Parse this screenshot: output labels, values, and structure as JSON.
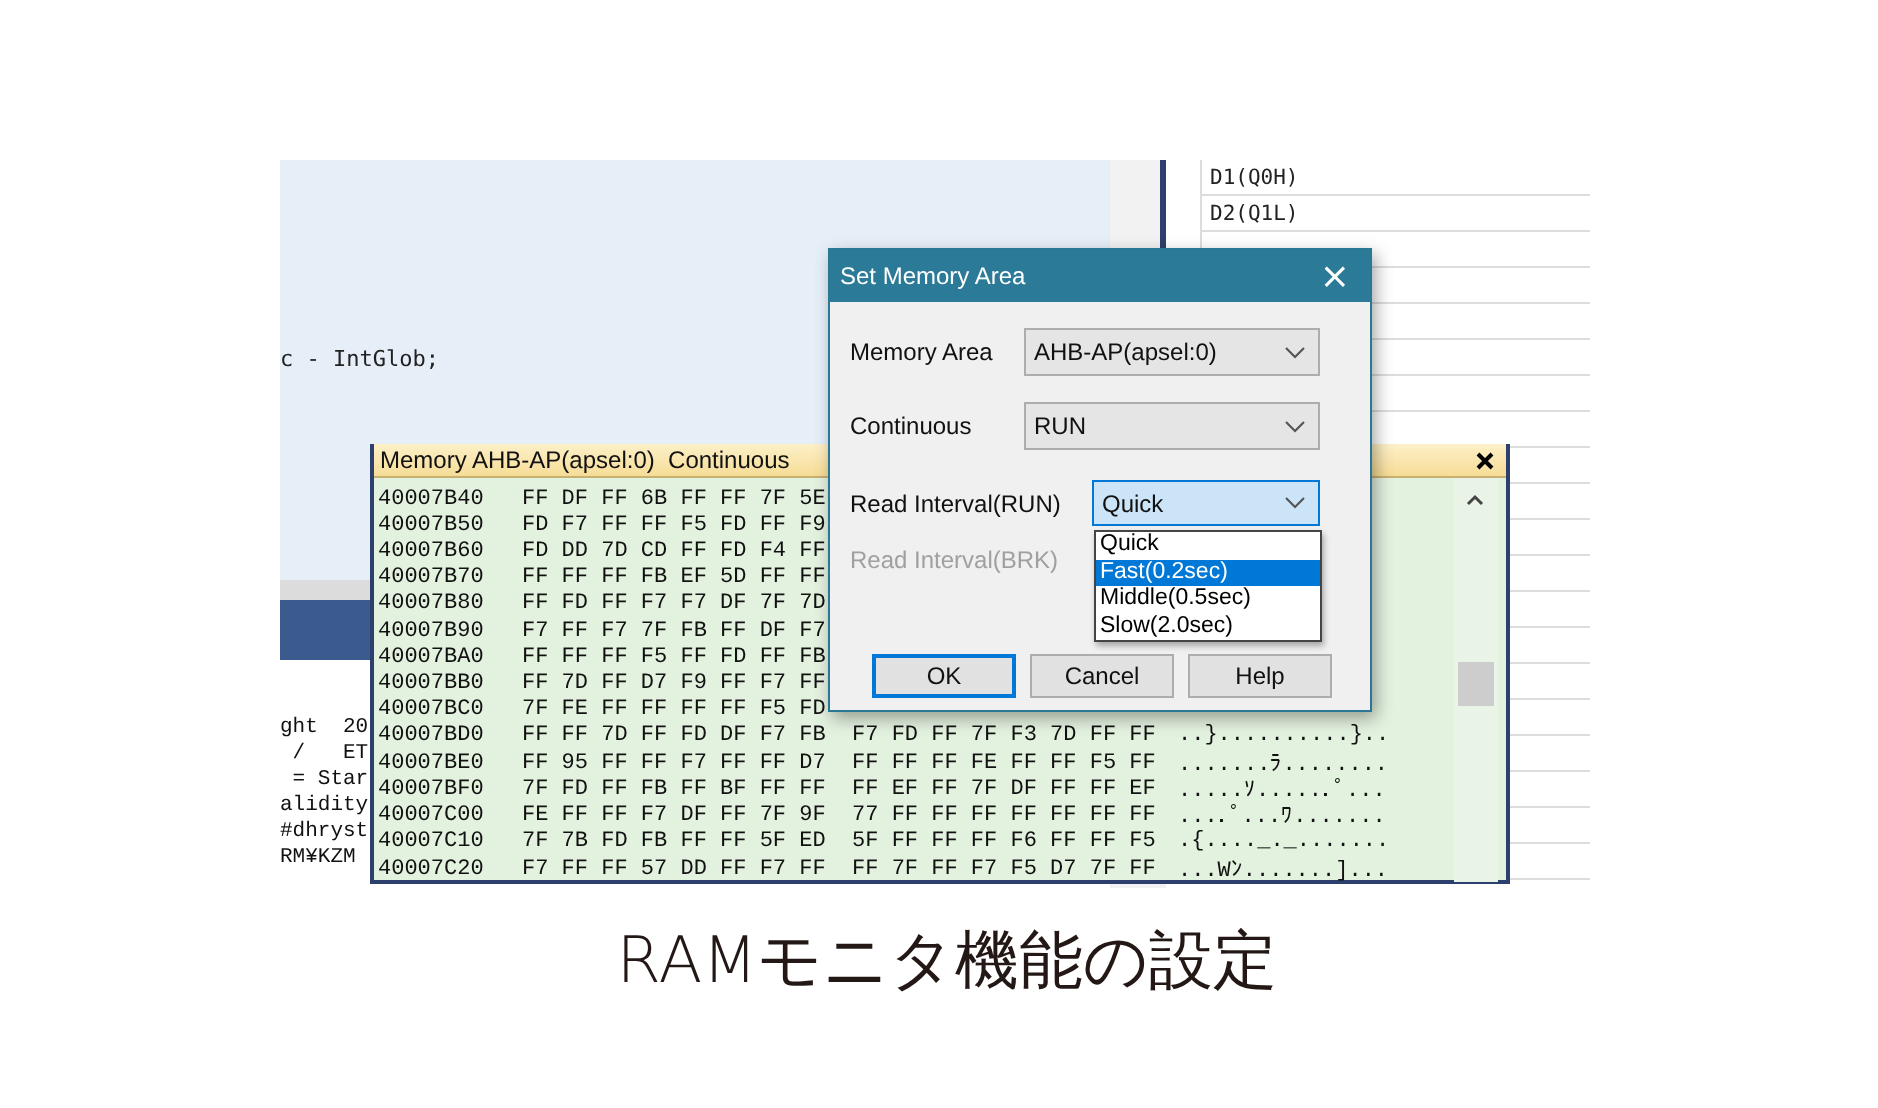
{
  "editor": {
    "code_line": "c - IntGlob;"
  },
  "console": {
    "lines": [
      "ght  20",
      " /   ET",
      " = Star",
      "alidity",
      "#dhryst",
      "RM¥KZM"
    ]
  },
  "register_panel": {
    "rows": [
      "D1(Q0H)",
      "D2(Q1L)"
    ]
  },
  "memory_window": {
    "title": "Memory AHB-AP(apsel:0)  Continuous",
    "rows": [
      {
        "address": "40007B40",
        "hex": "FF DF FF 6B FF FF 7F 5E"
      },
      {
        "address": "40007B50",
        "hex": "FD F7 FF FF F5 FD FF F9"
      },
      {
        "address": "40007B60",
        "hex": "FD DD 7D CD FF FD F4 FF"
      },
      {
        "address": "40007B70",
        "hex": "FF FF FF FB EF 5D FF FF"
      },
      {
        "address": "40007B80",
        "hex": "FF FD FF F7 F7 DF 7F 7D"
      },
      {
        "address": "40007B90",
        "hex": "F7 FF F7 7F FB FF DF F7"
      },
      {
        "address": "40007BA0",
        "hex": "FF FF FF F5 FF FD FF FB"
      },
      {
        "address": "40007BB0",
        "hex": "FF 7D FF D7 F9 FF F7 FF"
      },
      {
        "address": "40007BC0",
        "hex": "7F FE FF FF FF FF F5 FD"
      },
      {
        "address": "40007BD0",
        "hex": "FF FF 7D FF FD DF F7 FB  F7 FD FF 7F F3 7D FF FF",
        "ascii": "..}..........}.."
      },
      {
        "address": "40007BE0",
        "hex": "FF 95 FF FF F7 FF FF D7  FF FF FF FE FF FF F5 FF",
        "ascii": ".......ﾗ........"
      },
      {
        "address": "40007BF0",
        "hex": "7F FD FF FB FF BF FF FF  FF EF FF 7F DF FF FF EF",
        "ascii": ".....ｿ......ﾟ..."
      },
      {
        "address": "40007C00",
        "hex": "FE FF FF F7 DF FF 7F 9F  77 FF FF FF FF FF FF FF",
        "ascii": "....ﾟ...ﾜ......."
      },
      {
        "address": "40007C10",
        "hex": "7F 7B FD FB FF FF 5F ED  5F FF FF FF F6 FF FF F5",
        "ascii": ".{...._._......."
      },
      {
        "address": "40007C20",
        "hex": "F7 FF FF 57 DD FF F7 FF  FF 7F FF F7 F5 D7 7F FF",
        "ascii": "...Wﾝ.......]..."
      }
    ]
  },
  "dialog": {
    "title": "Set Memory Area",
    "close": "×",
    "fields": [
      {
        "label": "Memory Area",
        "value": "AHB-AP(apsel:0)",
        "disabled": false,
        "focused": false
      },
      {
        "label": "Continuous",
        "value": "RUN",
        "disabled": false,
        "focused": false
      },
      {
        "label": "Read Interval(RUN)",
        "value": "Quick",
        "disabled": false,
        "focused": true
      },
      {
        "label": "Read Interval(BRK)",
        "disabled": true
      }
    ],
    "dropdown": {
      "options": [
        {
          "label": "Quick",
          "selected": false
        },
        {
          "label": "Fast(0.2sec)",
          "selected": true
        },
        {
          "label": "Middle(0.5sec)",
          "selected": false
        },
        {
          "label": "Slow(2.0sec)",
          "selected": false
        }
      ]
    },
    "buttons": [
      {
        "label": "OK",
        "default": true
      },
      {
        "label": "Cancel",
        "default": false
      },
      {
        "label": "Help",
        "default": false
      }
    ]
  },
  "caption": "RAMモニタ機能の設定"
}
